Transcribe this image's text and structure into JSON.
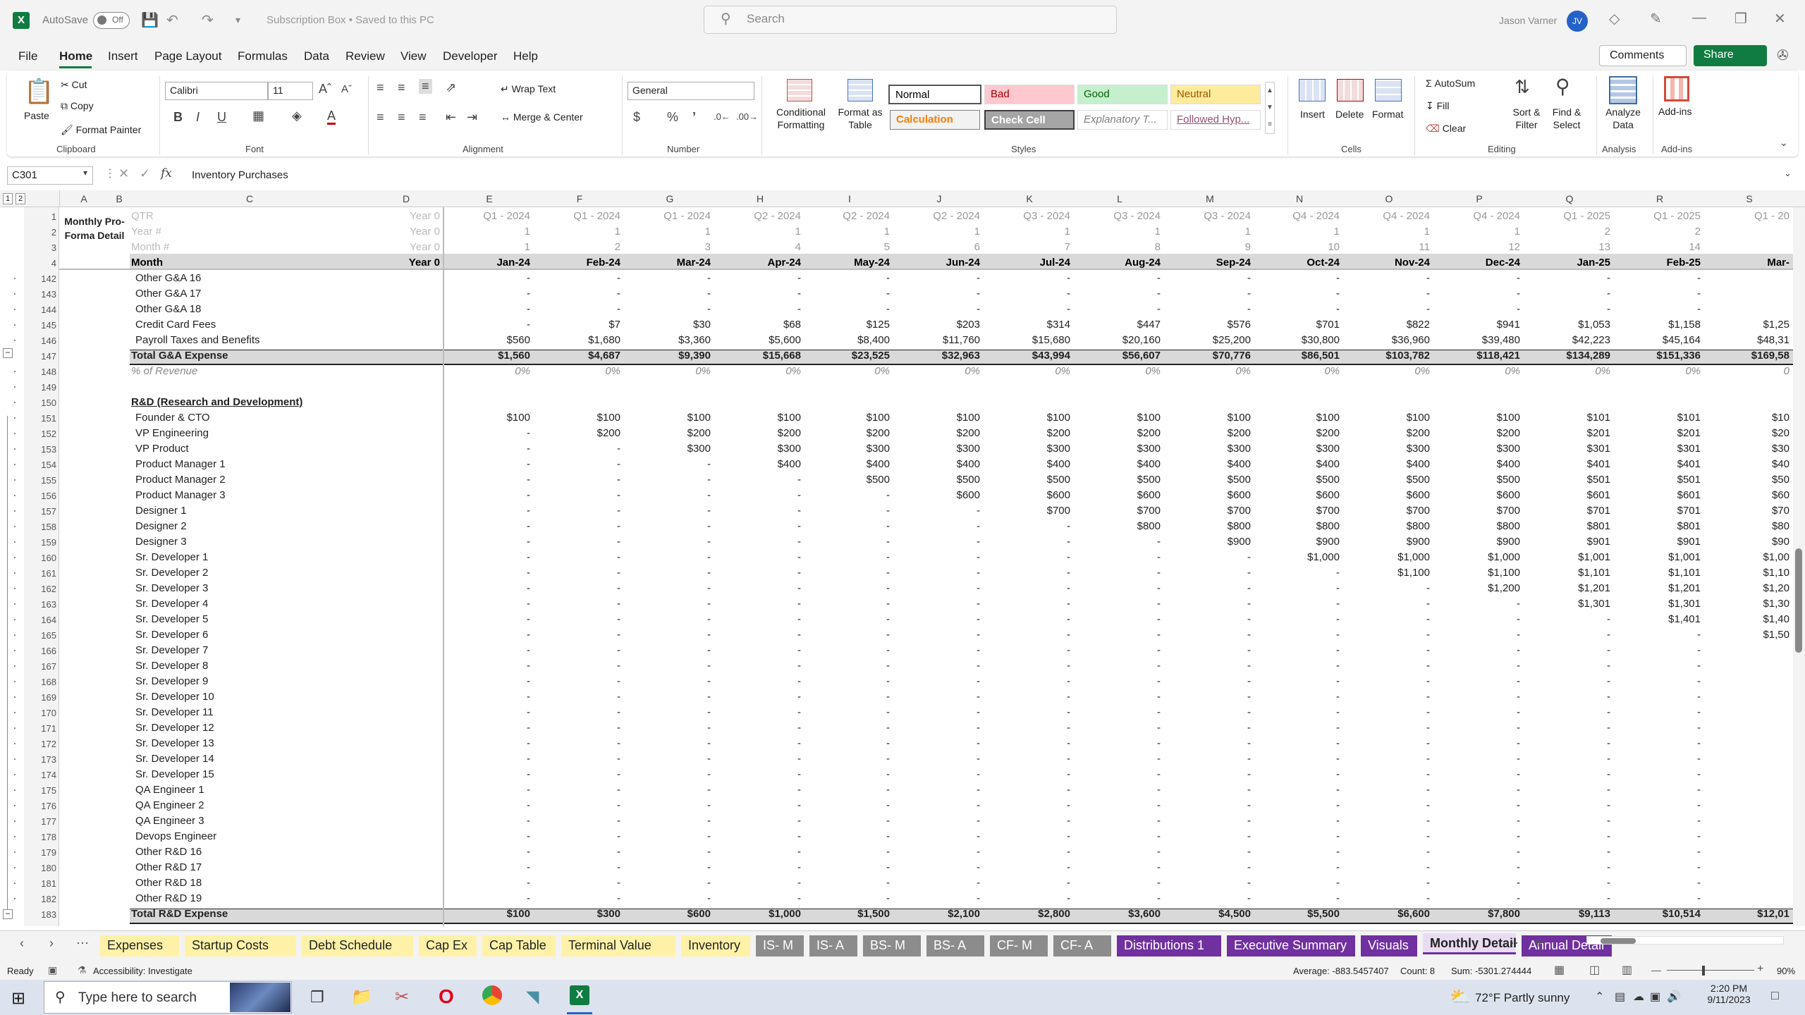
{
  "window": {
    "autosave_label": "AutoSave",
    "autosave_state": "Off",
    "doc_title": "Subscription Box • Saved to this PC",
    "search_placeholder": "Search",
    "user_name": "Jason Varner",
    "user_initials": "JV"
  },
  "menu": {
    "tabs": [
      "File",
      "Home",
      "Insert",
      "Page Layout",
      "Formulas",
      "Data",
      "Review",
      "View",
      "Developer",
      "Help"
    ],
    "comments": "Comments",
    "share": "Share"
  },
  "ribbon": {
    "clipboard": {
      "paste": "Paste",
      "cut": "Cut",
      "copy": "Copy",
      "format_painter": "Format Painter",
      "group": "Clipboard"
    },
    "font": {
      "name": "Calibri",
      "size": "11",
      "group": "Font"
    },
    "alignment": {
      "wrap": "Wrap Text",
      "merge": "Merge & Center",
      "group": "Alignment"
    },
    "number": {
      "format": "General",
      "group": "Number"
    },
    "styles": {
      "conditional": "Conditional Formatting",
      "format_table": "Format as Table",
      "normal": "Normal",
      "bad": "Bad",
      "good": "Good",
      "neutral": "Neutral",
      "calculation": "Calculation",
      "check": "Check Cell",
      "explanatory": "Explanatory T...",
      "followed": "Followed Hyp...",
      "group": "Styles"
    },
    "cells": {
      "insert": "Insert",
      "delete": "Delete",
      "format": "Format",
      "group": "Cells"
    },
    "editing": {
      "autosum": "AutoSum",
      "fill": "Fill",
      "clear": "Clear",
      "sort": "Sort & Filter",
      "find": "Find & Select",
      "group": "Editing"
    },
    "analysis": {
      "analyze": "Analyze Data",
      "group": "Analysis"
    },
    "addins": {
      "addins": "Add-ins",
      "group": "Add-ins"
    }
  },
  "formula_bar": {
    "name_box": "C301",
    "fx": "fx",
    "content": "Inventory Purchases"
  },
  "columns": [
    "A",
    "B",
    "C",
    "D",
    "E",
    "F",
    "G",
    "H",
    "I",
    "J",
    "K",
    "L",
    "M",
    "N",
    "O",
    "P",
    "Q",
    "R",
    "S"
  ],
  "header_rows": {
    "title": "Monthly Pro-Forma Detail",
    "labels": [
      "QTR",
      "Year #",
      "Month #",
      "Month"
    ],
    "year0": [
      "Year 0",
      "Year 0",
      "Year 0",
      "Year 0"
    ],
    "qtr": [
      "Q1 - 2024",
      "Q1 - 2024",
      "Q1 - 2024",
      "Q2 - 2024",
      "Q2 - 2024",
      "Q2 - 2024",
      "Q3 - 2024",
      "Q3 - 2024",
      "Q3 - 2024",
      "Q4 - 2024",
      "Q4 - 2024",
      "Q4 - 2024",
      "Q1 - 2025",
      "Q1 - 2025",
      "Q1 - 20"
    ],
    "year": [
      "1",
      "1",
      "1",
      "1",
      "1",
      "1",
      "1",
      "1",
      "1",
      "1",
      "1",
      "1",
      "2",
      "2",
      ""
    ],
    "month_num": [
      "1",
      "2",
      "3",
      "4",
      "5",
      "6",
      "7",
      "8",
      "9",
      "10",
      "11",
      "12",
      "13",
      "14",
      ""
    ],
    "months": [
      "Jan-24",
      "Feb-24",
      "Mar-24",
      "Apr-24",
      "May-24",
      "Jun-24",
      "Jul-24",
      "Aug-24",
      "Sep-24",
      "Oct-24",
      "Nov-24",
      "Dec-24",
      "Jan-25",
      "Feb-25",
      "Mar-"
    ]
  },
  "rows": [
    {
      "n": "142",
      "label": "Other G&A 16",
      "v": [
        "-",
        "-",
        "-",
        "-",
        "-",
        "-",
        "-",
        "-",
        "-",
        "-",
        "-",
        "-",
        "-",
        "-",
        ""
      ]
    },
    {
      "n": "143",
      "label": "Other G&A 17",
      "v": [
        "-",
        "-",
        "-",
        "-",
        "-",
        "-",
        "-",
        "-",
        "-",
        "-",
        "-",
        "-",
        "-",
        "-",
        ""
      ]
    },
    {
      "n": "144",
      "label": "Other G&A 18",
      "v": [
        "-",
        "-",
        "-",
        "-",
        "-",
        "-",
        "-",
        "-",
        "-",
        "-",
        "-",
        "-",
        "-",
        "-",
        ""
      ]
    },
    {
      "n": "145",
      "label": "Credit Card Fees",
      "v": [
        "-",
        "$7",
        "$30",
        "$68",
        "$125",
        "$203",
        "$314",
        "$447",
        "$576",
        "$701",
        "$822",
        "$941",
        "$1,053",
        "$1,158",
        "$1,25"
      ]
    },
    {
      "n": "146",
      "label": "Payroll Taxes and Benefits",
      "v": [
        "$560",
        "$1,680",
        "$3,360",
        "$5,600",
        "$8,400",
        "$11,760",
        "$15,680",
        "$20,160",
        "$25,200",
        "$30,800",
        "$36,960",
        "$39,480",
        "$42,223",
        "$45,164",
        "$48,31"
      ]
    },
    {
      "n": "147",
      "label": "Total G&A Expense",
      "style": "total",
      "v": [
        "$1,560",
        "$4,687",
        "$9,390",
        "$15,668",
        "$23,525",
        "$32,963",
        "$43,994",
        "$56,607",
        "$70,776",
        "$86,501",
        "$103,782",
        "$118,421",
        "$134,289",
        "$151,336",
        "$169,58"
      ]
    },
    {
      "n": "148",
      "label": "% of Revenue",
      "style": "pct",
      "v": [
        "0%",
        "0%",
        "0%",
        "0%",
        "0%",
        "0%",
        "0%",
        "0%",
        "0%",
        "0%",
        "0%",
        "0%",
        "0%",
        "0%",
        "0"
      ]
    },
    {
      "n": "149",
      "label": "",
      "v": [
        "",
        "",
        "",
        "",
        "",
        "",
        "",
        "",
        "",
        "",
        "",
        "",
        "",
        "",
        ""
      ]
    },
    {
      "n": "150",
      "label": "R&D (Research and Development)",
      "style": "section",
      "v": [
        "",
        "",
        "",
        "",
        "",
        "",
        "",
        "",
        "",
        "",
        "",
        "",
        "",
        "",
        ""
      ]
    },
    {
      "n": "151",
      "label": "Founder & CTO",
      "v": [
        "$100",
        "$100",
        "$100",
        "$100",
        "$100",
        "$100",
        "$100",
        "$100",
        "$100",
        "$100",
        "$100",
        "$100",
        "$101",
        "$101",
        "$10"
      ]
    },
    {
      "n": "152",
      "label": "VP Engineering",
      "v": [
        "-",
        "$200",
        "$200",
        "$200",
        "$200",
        "$200",
        "$200",
        "$200",
        "$200",
        "$200",
        "$200",
        "$200",
        "$201",
        "$201",
        "$20"
      ]
    },
    {
      "n": "153",
      "label": "VP Product",
      "v": [
        "-",
        "-",
        "$300",
        "$300",
        "$300",
        "$300",
        "$300",
        "$300",
        "$300",
        "$300",
        "$300",
        "$300",
        "$301",
        "$301",
        "$30"
      ]
    },
    {
      "n": "154",
      "label": "Product Manager 1",
      "v": [
        "-",
        "-",
        "-",
        "$400",
        "$400",
        "$400",
        "$400",
        "$400",
        "$400",
        "$400",
        "$400",
        "$400",
        "$401",
        "$401",
        "$40"
      ]
    },
    {
      "n": "155",
      "label": "Product Manager 2",
      "v": [
        "-",
        "-",
        "-",
        "-",
        "$500",
        "$500",
        "$500",
        "$500",
        "$500",
        "$500",
        "$500",
        "$500",
        "$501",
        "$501",
        "$50"
      ]
    },
    {
      "n": "156",
      "label": "Product Manager 3",
      "v": [
        "-",
        "-",
        "-",
        "-",
        "-",
        "$600",
        "$600",
        "$600",
        "$600",
        "$600",
        "$600",
        "$600",
        "$601",
        "$601",
        "$60"
      ]
    },
    {
      "n": "157",
      "label": "Designer 1",
      "v": [
        "-",
        "-",
        "-",
        "-",
        "-",
        "-",
        "$700",
        "$700",
        "$700",
        "$700",
        "$700",
        "$700",
        "$701",
        "$701",
        "$70"
      ]
    },
    {
      "n": "158",
      "label": "Designer 2",
      "v": [
        "-",
        "-",
        "-",
        "-",
        "-",
        "-",
        "-",
        "$800",
        "$800",
        "$800",
        "$800",
        "$800",
        "$801",
        "$801",
        "$80"
      ]
    },
    {
      "n": "159",
      "label": "Designer 3",
      "v": [
        "-",
        "-",
        "-",
        "-",
        "-",
        "-",
        "-",
        "-",
        "$900",
        "$900",
        "$900",
        "$900",
        "$901",
        "$901",
        "$90"
      ]
    },
    {
      "n": "160",
      "label": "Sr. Developer 1",
      "v": [
        "-",
        "-",
        "-",
        "-",
        "-",
        "-",
        "-",
        "-",
        "-",
        "$1,000",
        "$1,000",
        "$1,000",
        "$1,001",
        "$1,001",
        "$1,00"
      ]
    },
    {
      "n": "161",
      "label": "Sr. Developer 2",
      "v": [
        "-",
        "-",
        "-",
        "-",
        "-",
        "-",
        "-",
        "-",
        "-",
        "-",
        "$1,100",
        "$1,100",
        "$1,101",
        "$1,101",
        "$1,10"
      ]
    },
    {
      "n": "162",
      "label": "Sr. Developer 3",
      "v": [
        "-",
        "-",
        "-",
        "-",
        "-",
        "-",
        "-",
        "-",
        "-",
        "-",
        "-",
        "$1,200",
        "$1,201",
        "$1,201",
        "$1,20"
      ]
    },
    {
      "n": "163",
      "label": "Sr. Developer 4",
      "v": [
        "-",
        "-",
        "-",
        "-",
        "-",
        "-",
        "-",
        "-",
        "-",
        "-",
        "-",
        "-",
        "$1,301",
        "$1,301",
        "$1,30"
      ]
    },
    {
      "n": "164",
      "label": "Sr. Developer 5",
      "v": [
        "-",
        "-",
        "-",
        "-",
        "-",
        "-",
        "-",
        "-",
        "-",
        "-",
        "-",
        "-",
        "-",
        "$1,401",
        "$1,40"
      ]
    },
    {
      "n": "165",
      "label": "Sr. Developer 6",
      "v": [
        "-",
        "-",
        "-",
        "-",
        "-",
        "-",
        "-",
        "-",
        "-",
        "-",
        "-",
        "-",
        "-",
        "-",
        "$1,50"
      ]
    },
    {
      "n": "166",
      "label": "Sr. Developer 7",
      "v": [
        "-",
        "-",
        "-",
        "-",
        "-",
        "-",
        "-",
        "-",
        "-",
        "-",
        "-",
        "-",
        "-",
        "-",
        ""
      ]
    },
    {
      "n": "167",
      "label": "Sr. Developer 8",
      "v": [
        "-",
        "-",
        "-",
        "-",
        "-",
        "-",
        "-",
        "-",
        "-",
        "-",
        "-",
        "-",
        "-",
        "-",
        ""
      ]
    },
    {
      "n": "168",
      "label": "Sr. Developer 9",
      "v": [
        "-",
        "-",
        "-",
        "-",
        "-",
        "-",
        "-",
        "-",
        "-",
        "-",
        "-",
        "-",
        "-",
        "-",
        ""
      ]
    },
    {
      "n": "169",
      "label": "Sr. Developer 10",
      "v": [
        "-",
        "-",
        "-",
        "-",
        "-",
        "-",
        "-",
        "-",
        "-",
        "-",
        "-",
        "-",
        "-",
        "-",
        ""
      ]
    },
    {
      "n": "170",
      "label": "Sr. Developer 11",
      "v": [
        "-",
        "-",
        "-",
        "-",
        "-",
        "-",
        "-",
        "-",
        "-",
        "-",
        "-",
        "-",
        "-",
        "-",
        ""
      ]
    },
    {
      "n": "171",
      "label": "Sr. Developer 12",
      "v": [
        "-",
        "-",
        "-",
        "-",
        "-",
        "-",
        "-",
        "-",
        "-",
        "-",
        "-",
        "-",
        "-",
        "-",
        ""
      ]
    },
    {
      "n": "172",
      "label": "Sr. Developer 13",
      "v": [
        "-",
        "-",
        "-",
        "-",
        "-",
        "-",
        "-",
        "-",
        "-",
        "-",
        "-",
        "-",
        "-",
        "-",
        ""
      ]
    },
    {
      "n": "173",
      "label": "Sr. Developer 14",
      "v": [
        "-",
        "-",
        "-",
        "-",
        "-",
        "-",
        "-",
        "-",
        "-",
        "-",
        "-",
        "-",
        "-",
        "-",
        ""
      ]
    },
    {
      "n": "174",
      "label": "Sr. Developer 15",
      "v": [
        "-",
        "-",
        "-",
        "-",
        "-",
        "-",
        "-",
        "-",
        "-",
        "-",
        "-",
        "-",
        "-",
        "-",
        ""
      ]
    },
    {
      "n": "175",
      "label": "QA Engineer 1",
      "v": [
        "-",
        "-",
        "-",
        "-",
        "-",
        "-",
        "-",
        "-",
        "-",
        "-",
        "-",
        "-",
        "-",
        "-",
        ""
      ]
    },
    {
      "n": "176",
      "label": "QA Engineer 2",
      "v": [
        "-",
        "-",
        "-",
        "-",
        "-",
        "-",
        "-",
        "-",
        "-",
        "-",
        "-",
        "-",
        "-",
        "-",
        ""
      ]
    },
    {
      "n": "177",
      "label": "QA Engineer 3",
      "v": [
        "-",
        "-",
        "-",
        "-",
        "-",
        "-",
        "-",
        "-",
        "-",
        "-",
        "-",
        "-",
        "-",
        "-",
        ""
      ]
    },
    {
      "n": "178",
      "label": "Devops Engineer",
      "v": [
        "-",
        "-",
        "-",
        "-",
        "-",
        "-",
        "-",
        "-",
        "-",
        "-",
        "-",
        "-",
        "-",
        "-",
        ""
      ]
    },
    {
      "n": "179",
      "label": "Other R&D 16",
      "v": [
        "-",
        "-",
        "-",
        "-",
        "-",
        "-",
        "-",
        "-",
        "-",
        "-",
        "-",
        "-",
        "-",
        "-",
        ""
      ]
    },
    {
      "n": "180",
      "label": "Other R&D 17",
      "v": [
        "-",
        "-",
        "-",
        "-",
        "-",
        "-",
        "-",
        "-",
        "-",
        "-",
        "-",
        "-",
        "-",
        "-",
        ""
      ]
    },
    {
      "n": "181",
      "label": "Other R&D 18",
      "v": [
        "-",
        "-",
        "-",
        "-",
        "-",
        "-",
        "-",
        "-",
        "-",
        "-",
        "-",
        "-",
        "-",
        "-",
        ""
      ]
    },
    {
      "n": "182",
      "label": "Other R&D 19",
      "v": [
        "-",
        "-",
        "-",
        "-",
        "-",
        "-",
        "-",
        "-",
        "-",
        "-",
        "-",
        "-",
        "-",
        "-",
        ""
      ]
    },
    {
      "n": "183",
      "label": "Total R&D Expense",
      "style": "total",
      "v": [
        "$100",
        "$300",
        "$600",
        "$1,000",
        "$1,500",
        "$2,100",
        "$2,800",
        "$3,600",
        "$4,500",
        "$5,500",
        "$6,600",
        "$7,800",
        "$9,113",
        "$10,514",
        "$12,01"
      ]
    }
  ],
  "sheet_tabs": [
    {
      "name": "Expenses",
      "color": "#fff2a8",
      "text": "#222"
    },
    {
      "name": "Startup Costs",
      "color": "#fff2a8",
      "text": "#222"
    },
    {
      "name": "Debt Schedule",
      "color": "#fff2a8",
      "text": "#222"
    },
    {
      "name": "Cap Ex",
      "color": "#fff2a8",
      "text": "#222"
    },
    {
      "name": "Cap Table",
      "color": "#fff2a8",
      "text": "#222"
    },
    {
      "name": "Terminal Value",
      "color": "#fff2a8",
      "text": "#222"
    },
    {
      "name": "Inventory",
      "color": "#fff2a8",
      "text": "#222"
    },
    {
      "name": "IS- M",
      "color": "#8c8c8c",
      "text": "#fff"
    },
    {
      "name": "IS- A",
      "color": "#8c8c8c",
      "text": "#fff"
    },
    {
      "name": "BS- M",
      "color": "#8c8c8c",
      "text": "#fff"
    },
    {
      "name": "BS- A",
      "color": "#8c8c8c",
      "text": "#fff"
    },
    {
      "name": "CF- M",
      "color": "#8c8c8c",
      "text": "#fff"
    },
    {
      "name": "CF- A",
      "color": "#8c8c8c",
      "text": "#fff"
    },
    {
      "name": "Distributions 1",
      "color": "#7030a0",
      "text": "#fff"
    },
    {
      "name": "Executive Summary",
      "color": "#7030a0",
      "text": "#fff"
    },
    {
      "name": "Visuals",
      "color": "#7030a0",
      "text": "#fff"
    },
    {
      "name": "Monthly Detail",
      "color": "#e8dcf3",
      "text": "#222",
      "active": true
    },
    {
      "name": "Annual Detail",
      "color": "#7030a0",
      "text": "#fff"
    }
  ],
  "status": {
    "ready": "Ready",
    "accessibility": "Accessibility: Investigate",
    "average": "Average: -883.5457407",
    "count": "Count: 8",
    "sum": "Sum: -5301.274444",
    "zoom": "90%"
  },
  "taskbar": {
    "search_placeholder": "Type here to search",
    "weather": "72°F  Partly sunny",
    "time": "2:20 PM",
    "date": "9/11/2023"
  }
}
